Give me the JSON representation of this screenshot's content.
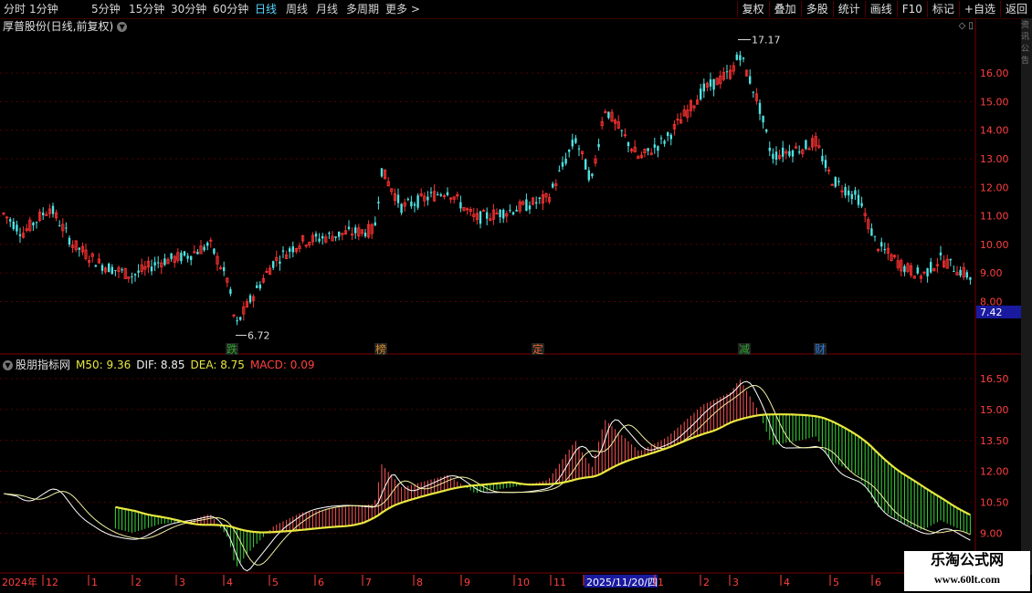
{
  "toolbar": {
    "periods": [
      "分时",
      "1分钟",
      "5分钟",
      "15分钟",
      "30分钟",
      "60分钟",
      "日线",
      "周线",
      "月线",
      "多周期"
    ],
    "active_period": "日线",
    "more_label": "更多",
    "more_arrow": ">",
    "tools": [
      "复权",
      "叠加",
      "多股",
      "统计",
      "画线",
      "F10",
      "标记",
      "+自选",
      "返回"
    ]
  },
  "stock": {
    "title": "厚普股份(日线,前复权)",
    "title_dropdown": "▼",
    "window_icons": "◇ ▯"
  },
  "price_chart": {
    "axis_labels": [
      "16.00",
      "15.00",
      "14.00",
      "13.00",
      "12.00",
      "11.00",
      "10.00",
      "9.00",
      "8.00"
    ],
    "axis_values": [
      16,
      15,
      14,
      13,
      12,
      11,
      10,
      9,
      8
    ],
    "current_price": "7.42",
    "high_label": "17.17",
    "low_label": "6.72",
    "events": [
      {
        "label": "跌",
        "color": "#2aa32a"
      },
      {
        "label": "榜",
        "color": "#d88a2a"
      },
      {
        "label": "定",
        "color": "#e0632a"
      },
      {
        "label": "减",
        "color": "#2aa32a"
      },
      {
        "label": "财",
        "color": "#2a7ae0"
      }
    ],
    "colors": {
      "up": "#ff3333",
      "down": "#4fe3e3",
      "axis": "#ff4040",
      "grid": "#5a0000"
    }
  },
  "indicator": {
    "dropdown": "▼",
    "name": "股朋指标网",
    "m50": "M50: 9.36",
    "dif": "DIF: 8.85",
    "dea": "DEA: 8.75",
    "macd": "MACD: 0.09",
    "axis_labels": [
      "16.50",
      "15.00",
      "13.50",
      "12.00",
      "10.50",
      "9.00"
    ],
    "axis_values": [
      16.5,
      15,
      13.5,
      12,
      10.5,
      9
    ],
    "colors": {
      "m50": "#e8e840",
      "dif": "#ffffff",
      "dea": "#e8e840",
      "hist_up": "#ff5555",
      "hist_down": "#3ad83a"
    }
  },
  "date_axis": {
    "year_label": "2024年",
    "ticks": [
      "12",
      "1",
      "2",
      "3",
      "4",
      "5",
      "6",
      "7",
      "8",
      "9",
      "10",
      "11",
      "2025/11/20/四",
      "1",
      "2",
      "3",
      "4",
      "5",
      "6"
    ],
    "highlight": "2025/11/20/四"
  },
  "right_strip_text": "资讯公告",
  "watermark": {
    "line1": "乐淘公式网",
    "line2": "www.60lt.com"
  }
}
